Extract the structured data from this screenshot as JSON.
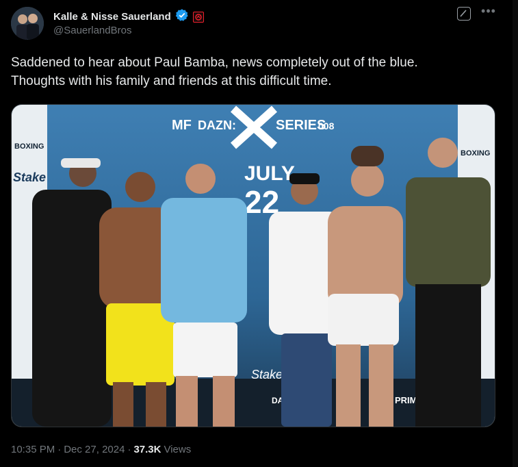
{
  "author": {
    "display_name": "Kalle & Nisse Sauerland",
    "handle": "@SauerlandBros"
  },
  "icons": {
    "verified": "verified-badge-icon",
    "affiliate": "affiliate-badge-icon",
    "grok": "grok-icon",
    "more": "more-options-icon"
  },
  "tweet": {
    "text": "Saddened to hear about Paul Bamba, news completely out of the blue.\nThoughts with his family and friends at this difficult time."
  },
  "media": {
    "banner_left": "MF",
    "banner_mid": "DAZN:",
    "banner_right": "SERIES",
    "banner_num": "008",
    "boxing_left": "BOXING",
    "boxing_right": "BOXING",
    "date_month": "JULY",
    "date_day": "22",
    "stake": "Stake",
    "dazn": "DAZN",
    "prime": "PRIME"
  },
  "meta": {
    "time": "10:35 PM",
    "sep1": "·",
    "date": "Dec 27, 2024",
    "sep2": "·",
    "views_count": "37.3K",
    "views_label": "Views"
  },
  "colors": {
    "background": "#000000",
    "text": "#e7e9ea",
    "muted": "#71767b",
    "verified": "#1d9bf0",
    "affiliate": "#f4212e"
  }
}
